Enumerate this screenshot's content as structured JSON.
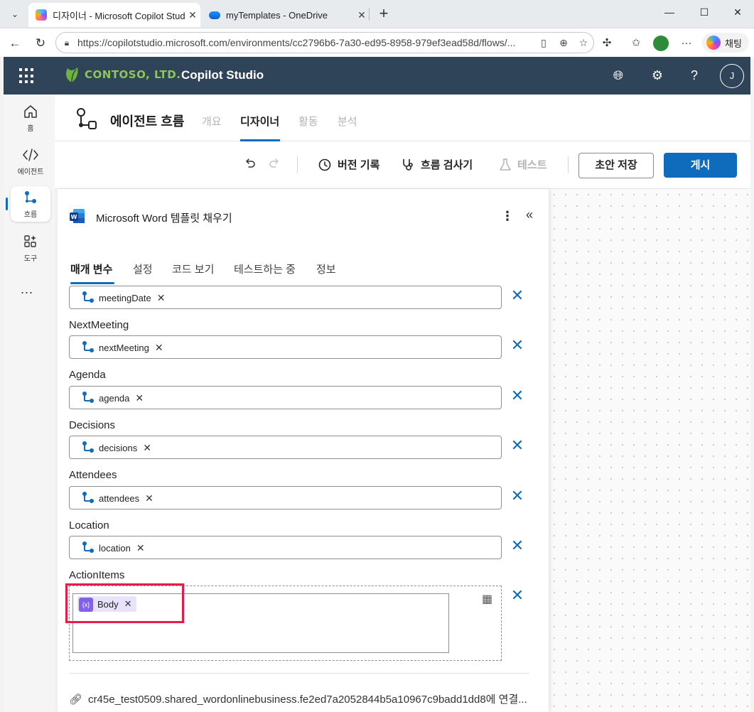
{
  "browser": {
    "tabs": [
      {
        "title": "디자이너 - Microsoft Copilot Studio",
        "active": true
      },
      {
        "title": "myTemplates - OneDrive",
        "active": false
      }
    ],
    "url": "https://copilotstudio.microsoft.com/environments/cc2796b6-7a30-ed95-8958-979ef3ead58d/flows/...",
    "copilot_label": "채팅"
  },
  "app": {
    "brand": "CONTOSO, LTD.",
    "product": "Copilot Studio",
    "avatar_initial": "J"
  },
  "rail": {
    "items": [
      {
        "label": "홈",
        "icon": "home-icon"
      },
      {
        "label": "에이전트",
        "icon": "code-icon"
      },
      {
        "label": "흐름",
        "icon": "flow-icon",
        "selected": true
      },
      {
        "label": "도구",
        "icon": "tools-icon"
      }
    ],
    "more": "..."
  },
  "page": {
    "title": "에이전트 흐름",
    "tabs": [
      "개요",
      "디자이너",
      "활동",
      "분석"
    ],
    "active_tab": "디자이너"
  },
  "toolbar": {
    "version_history": "버전 기록",
    "flow_checker": "흐름 검사기",
    "test": "테스트",
    "save_draft": "초안 저장",
    "publish": "게시"
  },
  "panel": {
    "title": "Microsoft Word 템플릿 채우기",
    "tabs": [
      "매개 변수",
      "설정",
      "코드 보기",
      "테스트하는 중",
      "정보"
    ],
    "fields": [
      {
        "label": "",
        "token": "meetingDate"
      },
      {
        "label": "NextMeeting",
        "token": "nextMeeting"
      },
      {
        "label": "Agenda",
        "token": "agenda"
      },
      {
        "label": "Decisions",
        "token": "decisions"
      },
      {
        "label": "Attendees",
        "token": "attendees"
      },
      {
        "label": "Location",
        "token": "location"
      }
    ],
    "action_items": {
      "label": "ActionItems",
      "token": "Body"
    },
    "connection": "cr45e_test0509.shared_wordonlinebusiness.fe2ed7a2052844b5a10967c9badd1dd8에 연결..."
  },
  "colors": {
    "appbar": "#2f4459",
    "accent": "#0f6cbd",
    "highlight": "#e11d48",
    "body_token": "#8061e8"
  }
}
